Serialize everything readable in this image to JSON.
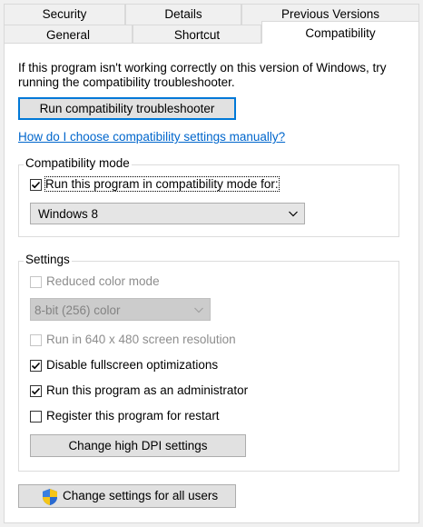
{
  "tabs": {
    "row1": [
      "Security",
      "Details",
      "Previous Versions"
    ],
    "row2": [
      "General",
      "Shortcut",
      "Compatibility"
    ],
    "active": "Compatibility"
  },
  "intro_text": "If this program isn't working correctly on this version of Windows, try running the compatibility troubleshooter.",
  "intro_line1": "If this program isn't working correctly on this version of Windows, try",
  "intro_line2": "running the compatibility troubleshooter.",
  "run_troubleshooter_label": "Run compatibility troubleshooter",
  "manual_link": "How do I choose compatibility settings manually?",
  "compat_mode": {
    "title": "Compatibility mode",
    "checkbox_label": "Run this program in compatibility mode for:",
    "checked": true,
    "selected_os": "Windows 8"
  },
  "settings": {
    "title": "Settings",
    "reduced_color": {
      "label": "Reduced color mode",
      "checked": false,
      "enabled": false
    },
    "color_select": "8-bit (256) color",
    "resolution_640": {
      "label": "Run in 640 x 480 screen resolution",
      "checked": false,
      "enabled": false
    },
    "disable_fullscreen": {
      "label": "Disable fullscreen optimizations",
      "checked": true,
      "enabled": true
    },
    "run_as_admin": {
      "label": "Run this program as an administrator",
      "checked": true,
      "enabled": true
    },
    "register_restart": {
      "label": "Register this program for restart",
      "checked": false,
      "enabled": true
    },
    "dpi_button": "Change high DPI settings"
  },
  "all_users_button": "Change settings for all users",
  "icons": {
    "checkmark": "checkmark-icon",
    "dropdown": "chevron-down-icon",
    "shield": "uac-shield-icon"
  },
  "colors": {
    "accent": "#0078d7",
    "link": "#0066cc",
    "disabled_text": "#8d8d8d"
  }
}
